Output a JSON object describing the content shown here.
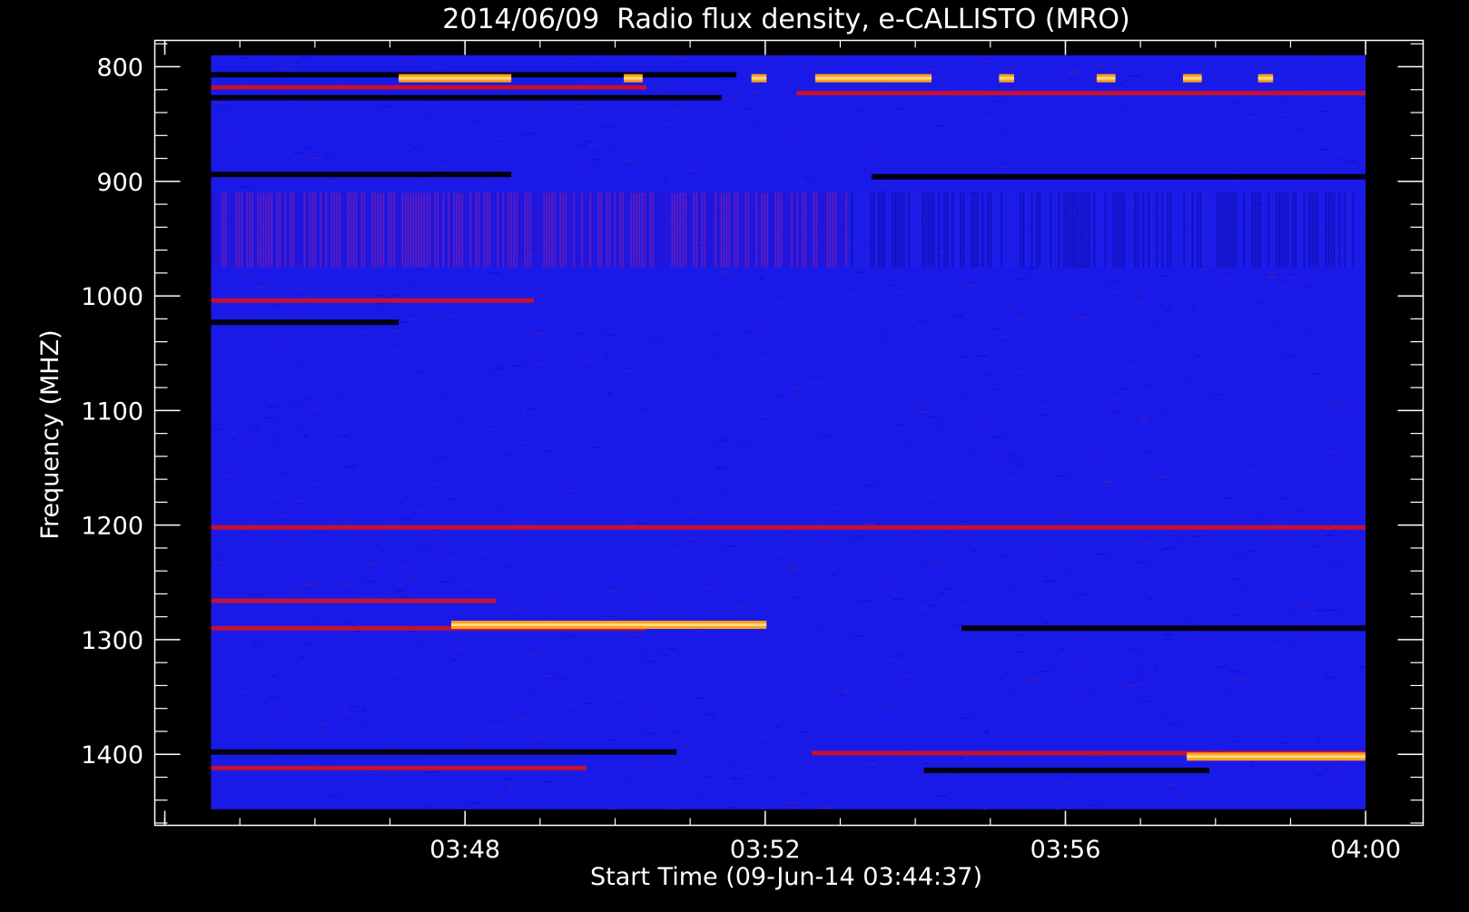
{
  "chart_data": {
    "type": "heatmap",
    "title": "2014/06/09  Radio flux density, e-CALLISTO (MRO)",
    "xlabel": "Start Time (09-Jun-14 03:44:37)",
    "ylabel": "Frequency (MHZ)",
    "x_ticks": [
      "03:48",
      "03:52",
      "03:56",
      "04:00"
    ],
    "x_tick_minutes": [
      3.3833,
      7.3833,
      11.3833,
      15.3833
    ],
    "xlim_minutes": [
      0,
      15.3833
    ],
    "axis_frame_minutes": [
      -0.75,
      16.15
    ],
    "y_ticks": [
      "800",
      "900",
      "1000",
      "1100",
      "1200",
      "1300",
      "1400"
    ],
    "y_tick_values": [
      800,
      900,
      1000,
      1100,
      1200,
      1300,
      1400
    ],
    "ylim": [
      790,
      1448
    ],
    "axis_frame_ylim": [
      777,
      1462
    ],
    "y_inverted": true,
    "colormap": [
      "#000000",
      "#0000ff",
      "#ff0000",
      "#ffa000",
      "#ffe080"
    ],
    "background_color": "#1a1ae8",
    "features": [
      {
        "freq": 807,
        "t0": 0.0,
        "t1": 7.0,
        "kind": "dark"
      },
      {
        "freq": 818,
        "t0": 0.0,
        "t1": 5.8,
        "kind": "red"
      },
      {
        "freq": 810,
        "t0": 2.5,
        "t1": 4.0,
        "kind": "orange"
      },
      {
        "freq": 810,
        "t0": 5.5,
        "t1": 5.75,
        "kind": "orange"
      },
      {
        "freq": 810,
        "t0": 7.2,
        "t1": 7.4,
        "kind": "orange"
      },
      {
        "freq": 810,
        "t0": 8.05,
        "t1": 9.6,
        "kind": "orange"
      },
      {
        "freq": 810,
        "t0": 10.5,
        "t1": 10.7,
        "kind": "orange"
      },
      {
        "freq": 810,
        "t0": 11.8,
        "t1": 12.05,
        "kind": "orange"
      },
      {
        "freq": 810,
        "t0": 12.95,
        "t1": 13.2,
        "kind": "orange"
      },
      {
        "freq": 810,
        "t0": 13.95,
        "t1": 14.15,
        "kind": "orange"
      },
      {
        "freq": 823,
        "t0": 7.8,
        "t1": 15.38,
        "kind": "red"
      },
      {
        "freq": 827,
        "t0": 0.0,
        "t1": 6.8,
        "kind": "dark"
      },
      {
        "freq": 894,
        "t0": 0.0,
        "t1": 4.0,
        "kind": "dark"
      },
      {
        "freq": 896,
        "t0": 8.8,
        "t1": 15.38,
        "kind": "dark"
      },
      {
        "freq": 1004,
        "t0": 0.0,
        "t1": 4.3,
        "kind": "red"
      },
      {
        "freq": 1023,
        "t0": 0.0,
        "t1": 2.5,
        "kind": "dark"
      },
      {
        "freq": 1202,
        "t0": 0.0,
        "t1": 15.38,
        "kind": "red"
      },
      {
        "freq": 1266,
        "t0": 0.0,
        "t1": 3.8,
        "kind": "red"
      },
      {
        "freq": 1290,
        "t0": 0.0,
        "t1": 5.8,
        "kind": "red"
      },
      {
        "freq": 1287,
        "t0": 3.2,
        "t1": 7.4,
        "kind": "orange"
      },
      {
        "freq": 1290,
        "t0": 10.0,
        "t1": 15.38,
        "kind": "dark"
      },
      {
        "freq": 1398,
        "t0": 0.0,
        "t1": 6.2,
        "kind": "dark"
      },
      {
        "freq": 1399,
        "t0": 8.0,
        "t1": 15.38,
        "kind": "red"
      },
      {
        "freq": 1402,
        "t0": 13.0,
        "t1": 15.38,
        "kind": "orange"
      },
      {
        "freq": 1412,
        "t0": 0.0,
        "t1": 5.0,
        "kind": "red"
      },
      {
        "freq": 1414,
        "t0": 9.5,
        "t1": 13.3,
        "kind": "dark"
      }
    ]
  }
}
